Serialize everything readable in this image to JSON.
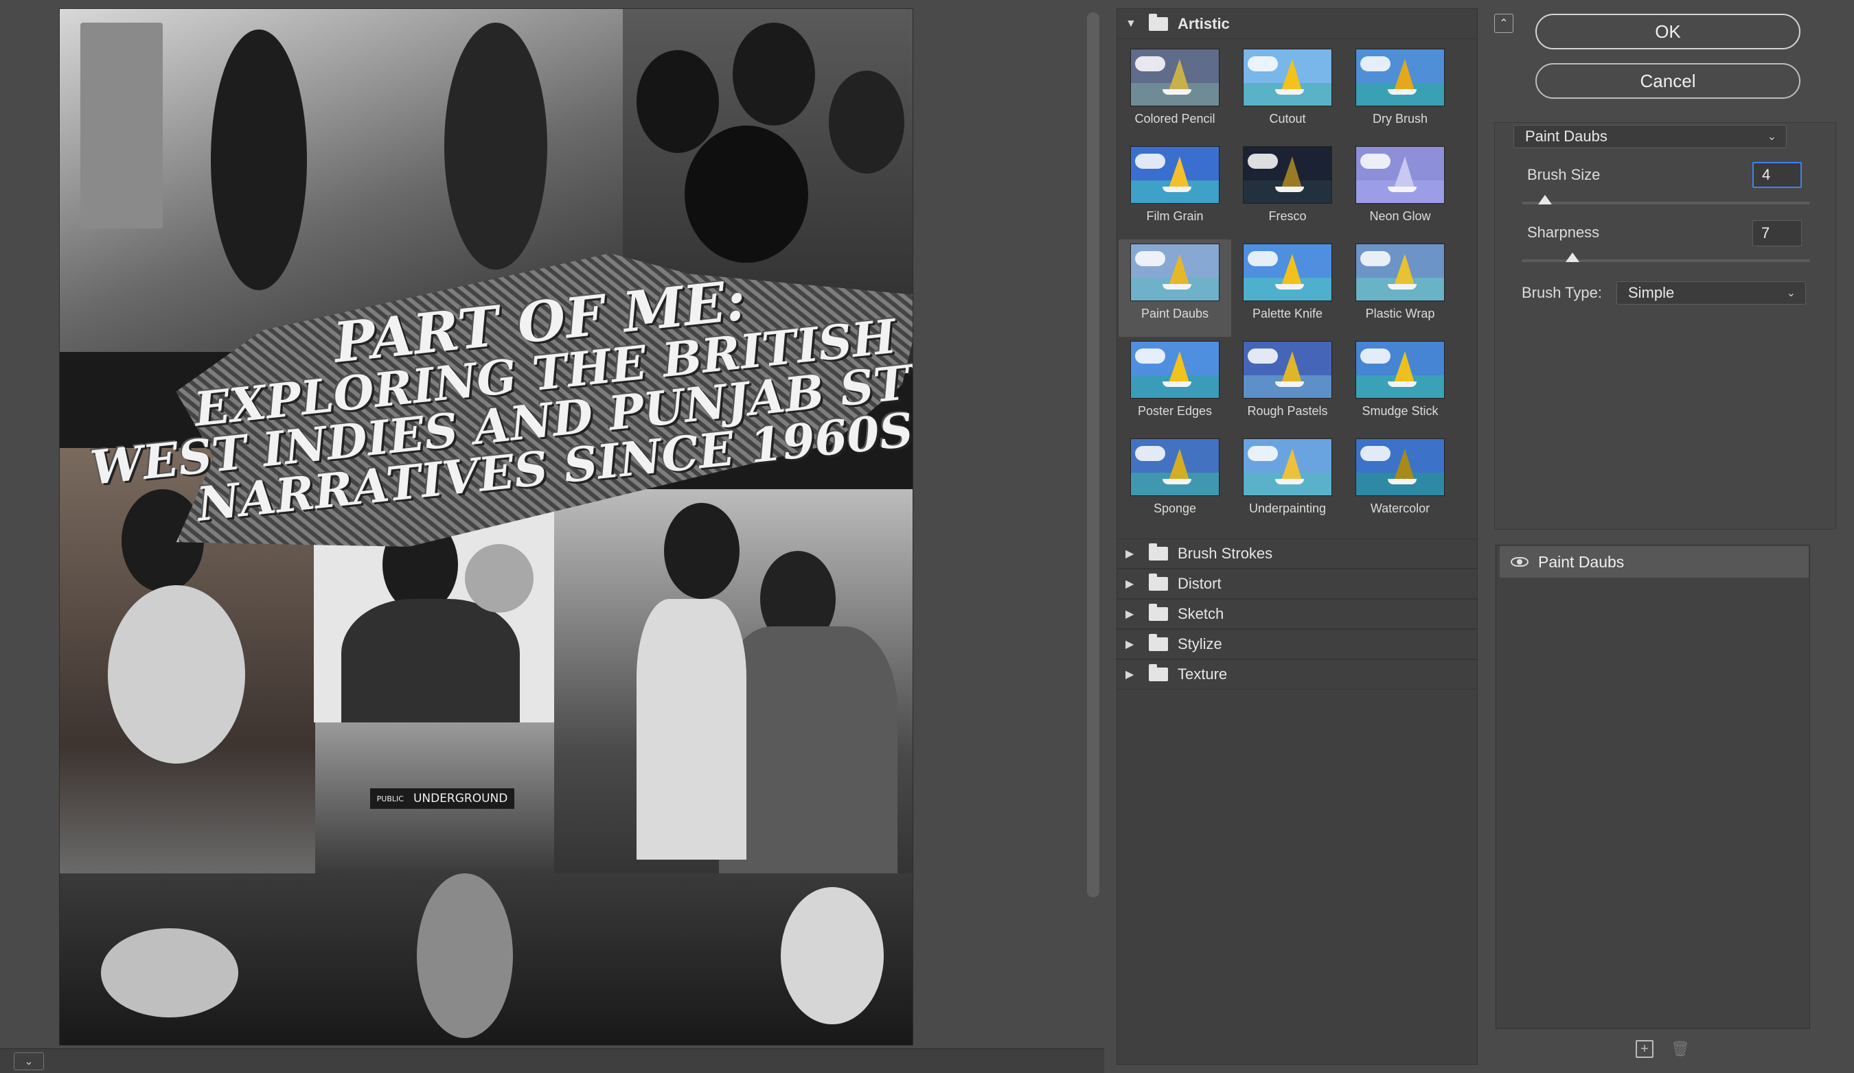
{
  "poster": {
    "title_lines": [
      "PART OF ME:",
      "EXPLORING THE BRITISH",
      "WEST INDIES AND PUNJAB STYLE",
      "NARRATIVES SINCE 1960s"
    ],
    "sign_text": "UNDERGROUND",
    "sign_small": "PUBLIC"
  },
  "gallery": {
    "open_category": "Artistic",
    "filters": [
      {
        "label": "Colored Pencil",
        "sky": "#5f6c8a",
        "sea": "#6f8c96",
        "sail": "#c9b04a"
      },
      {
        "label": "Cutout",
        "sky": "#79b6ea",
        "sea": "#59b2c6",
        "sail": "#f3c21d"
      },
      {
        "label": "Dry Brush",
        "sky": "#4f8fd8",
        "sea": "#3aa0b4",
        "sail": "#e3a91b"
      },
      {
        "label": "Film Grain",
        "sky": "#3a6fd0",
        "sea": "#3fa0c8",
        "sail": "#f2c02b"
      },
      {
        "label": "Fresco",
        "sky": "#1b2233",
        "sea": "#23313e",
        "sail": "#9a7b24"
      },
      {
        "label": "Neon Glow",
        "sky": "#8d8fd8",
        "sea": "#9b9ee6",
        "sail": "#c8c8f0"
      },
      {
        "label": "Paint Daubs",
        "sky": "#87a8d2",
        "sea": "#6fb1c9",
        "sail": "#e7b72a"
      },
      {
        "label": "Palette Knife",
        "sky": "#4f8fe0",
        "sea": "#4eb0cd",
        "sail": "#f1c21e"
      },
      {
        "label": "Plastic Wrap",
        "sky": "#6d94c7",
        "sea": "#6ab2c6",
        "sail": "#e9c230"
      },
      {
        "label": "Poster Edges",
        "sky": "#4f8fe0",
        "sea": "#3a9cb8",
        "sail": "#f2c21d"
      },
      {
        "label": "Rough Pastels",
        "sky": "#4566b8",
        "sea": "#5d8fc8",
        "sail": "#e1b52a"
      },
      {
        "label": "Smudge Stick",
        "sky": "#4585d4",
        "sea": "#3aa2b6",
        "sail": "#eec01f"
      },
      {
        "label": "Sponge",
        "sky": "#4272c0",
        "sea": "#3f98b0",
        "sail": "#d4ad25"
      },
      {
        "label": "Underpainting",
        "sky": "#6aa4e0",
        "sea": "#5ab2ca",
        "sail": "#eec13a"
      },
      {
        "label": "Watercolor",
        "sky": "#3c72c8",
        "sea": "#2e8aa4",
        "sail": "#a88a1a"
      }
    ],
    "selected_filter": "Paint Daubs",
    "collapsed_categories": [
      "Brush Strokes",
      "Distort",
      "Sketch",
      "Stylize",
      "Texture"
    ]
  },
  "buttons": {
    "ok": "OK",
    "cancel": "Cancel"
  },
  "settings": {
    "filter_name": "Paint Daubs",
    "brush_size_label": "Brush Size",
    "brush_size_value": "4",
    "brush_size_fraction": 0.08,
    "sharpness_label": "Sharpness",
    "sharpness_value": "7",
    "sharpness_fraction": 0.175,
    "brush_type_label": "Brush Type:",
    "brush_type_value": "Simple"
  },
  "layers": {
    "items": [
      {
        "label": "Paint Daubs",
        "visible": true
      }
    ]
  },
  "colors": {
    "accent_focus": "#3f82f0",
    "selected_row": "#575757"
  }
}
